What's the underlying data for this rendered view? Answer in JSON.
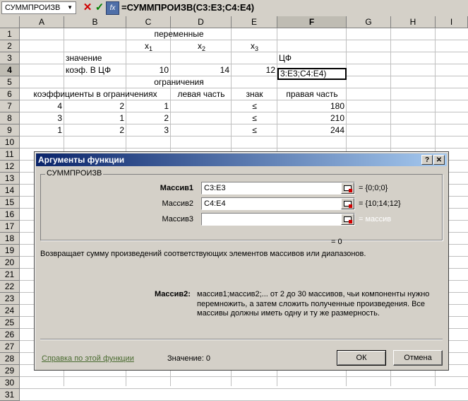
{
  "formula_bar": {
    "name_box": "СУММПРОИЗВ",
    "cancel_icon": "✕",
    "enter_icon": "✓",
    "fx_icon": "fx",
    "formula": "=СУММПРОИЗВ(C3:E3;C4:E4)"
  },
  "sheet": {
    "columns": [
      "A",
      "B",
      "C",
      "D",
      "E",
      "F",
      "G",
      "H",
      "I"
    ],
    "rows": [
      "1",
      "2",
      "3",
      "4",
      "5",
      "6",
      "7",
      "8",
      "9",
      "10",
      "11",
      "12",
      "13",
      "14",
      "15",
      "16",
      "17",
      "18",
      "19",
      "20",
      "21",
      "22",
      "23",
      "24",
      "25",
      "26",
      "27",
      "28",
      "29",
      "30",
      "31"
    ],
    "cells": {
      "c1": "переменные",
      "x": "x",
      "sub1": "1",
      "sub2": "2",
      "sub3": "3",
      "b3": "значение",
      "f3": "ЦФ",
      "b4": "коэф. В ЦФ",
      "c4": "10",
      "d4": "14",
      "e4": "12",
      "f4": "3:E3;C4:E4)",
      "c5": "ограничения",
      "a6": "коэффициенты в ограничениях",
      "d6": "левая часть",
      "e6": "знак",
      "f6": "правая часть",
      "a7": "4",
      "b7": "2",
      "c7": "1",
      "e7": "≤",
      "f7": "180",
      "a8": "3",
      "b8": "1",
      "c8": "2",
      "e8": "≤",
      "f8": "210",
      "a9": "1",
      "b9": "2",
      "c9": "3",
      "e9": "≤",
      "f9": "244"
    }
  },
  "dialog": {
    "title": "Аргументы функции",
    "help_icon": "?",
    "close_icon": "✕",
    "group_label": "СУММПРОИЗВ",
    "args": [
      {
        "label": "Массив1",
        "value": "C3:E3",
        "result": "= {0;0;0}"
      },
      {
        "label": "Массив2",
        "value": "C4:E4",
        "result": "= {10;14;12}"
      },
      {
        "label": "Массив3",
        "value": "",
        "result": "= массив"
      }
    ],
    "total_result": "= 0",
    "description": "Возвращает сумму произведений соответствующих элементов массивов или диапазонов.",
    "arg_help_name": "Массив2:",
    "arg_help_text": "массив1;массив2;... от 2 до 30 массивов, чьи компоненты нужно перемножить, а затем сложить полученные произведения. Все массивы должны иметь одну и ту же размерность.",
    "help_link": "Справка по этой функции",
    "value_label": "Значение:",
    "value": "0",
    "ok_label": "ОК",
    "cancel_label": "Отмена"
  },
  "colors": {
    "title_start": "#0a246a",
    "title_end": "#a6caf0",
    "face": "#d4d0c8"
  }
}
